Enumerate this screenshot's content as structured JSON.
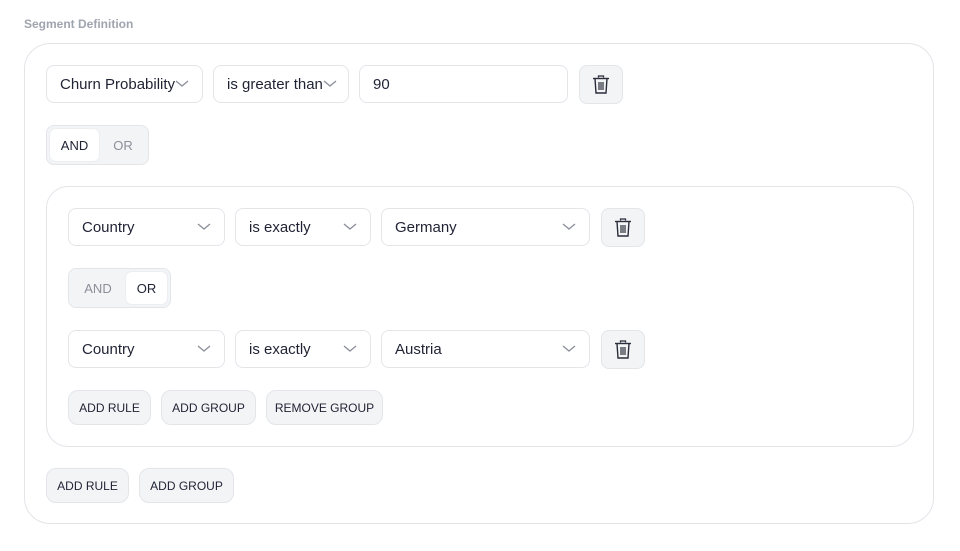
{
  "header": {
    "title": "Segment Definition"
  },
  "root_rule": {
    "field": "Churn Probability",
    "operator": "is greater than",
    "value": "90"
  },
  "root_logic": {
    "options": [
      "AND",
      "OR"
    ],
    "selected": "AND"
  },
  "group": {
    "rules": [
      {
        "field": "Country",
        "operator": "is exactly",
        "value": "Germany"
      },
      {
        "field": "Country",
        "operator": "is exactly",
        "value": "Austria"
      }
    ],
    "logic": {
      "options": [
        "AND",
        "OR"
      ],
      "selected": "OR"
    },
    "actions": {
      "add_rule": "ADD RULE",
      "add_group": "ADD GROUP",
      "remove_group": "REMOVE GROUP"
    }
  },
  "root_actions": {
    "add_rule": "ADD RULE",
    "add_group": "ADD GROUP"
  },
  "icons": {
    "delete": "trash-icon",
    "dropdown": "chevron-down-icon"
  }
}
